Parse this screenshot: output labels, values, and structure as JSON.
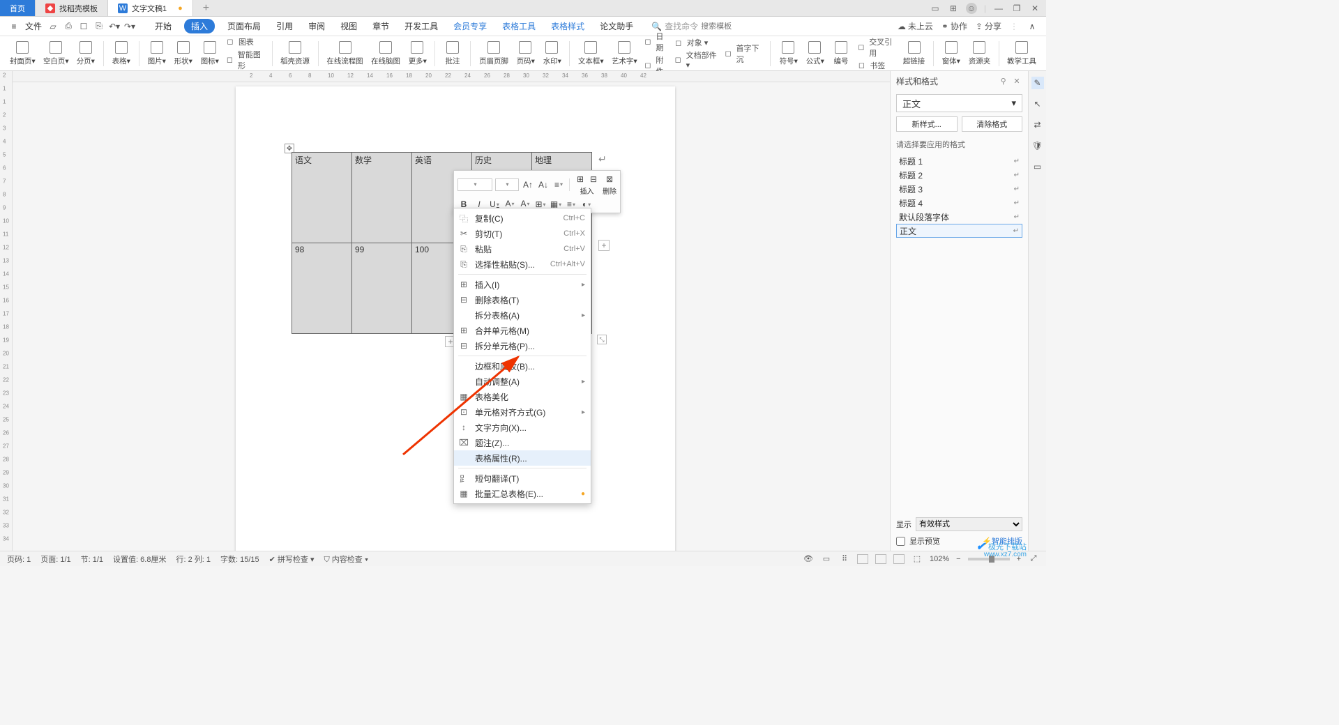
{
  "tabs": {
    "home": "首页",
    "template": "找稻壳模板",
    "doc": "文字文稿1"
  },
  "menubar": {
    "file": "文件",
    "tabs": [
      "开始",
      "插入",
      "页面布局",
      "引用",
      "审阅",
      "视图",
      "章节",
      "开发工具",
      "会员专享",
      "表格工具",
      "表格样式",
      "论文助手"
    ],
    "active": 1,
    "blue_idx": [
      8,
      9,
      10
    ],
    "search_icon_label": "查找命令",
    "search_placeholder": "搜索模板",
    "cloud": "未上云",
    "coop": "协作",
    "share": "分享"
  },
  "ribbon": [
    {
      "label": "封面页",
      "drop": true
    },
    {
      "label": "空白页",
      "drop": true
    },
    {
      "label": "分页",
      "drop": true
    },
    {
      "sep": true
    },
    {
      "label": "表格",
      "drop": true
    },
    {
      "sep": true
    },
    {
      "label": "图片",
      "drop": true
    },
    {
      "label": "形状",
      "drop": true
    },
    {
      "label": "图标",
      "drop": true
    },
    {
      "side": [
        {
          "label": "图表"
        },
        {
          "label": "智能图形"
        }
      ]
    },
    {
      "sep": true
    },
    {
      "label": "稻壳资源"
    },
    {
      "sep": true
    },
    {
      "label": "在线流程图"
    },
    {
      "label": "在线脑图"
    },
    {
      "label": "更多",
      "drop": true
    },
    {
      "sep": true
    },
    {
      "label": "批注"
    },
    {
      "sep": true
    },
    {
      "label": "页眉页脚"
    },
    {
      "label": "页码",
      "drop": true
    },
    {
      "label": "水印",
      "drop": true
    },
    {
      "sep": true
    },
    {
      "label": "文本框",
      "drop": true
    },
    {
      "label": "艺术字",
      "drop": true
    },
    {
      "side": [
        {
          "label": "日期"
        },
        {
          "label": "附件"
        }
      ]
    },
    {
      "side": [
        {
          "label": "对象"
        },
        {
          "label": "文档部件"
        }
      ],
      "drop": true
    },
    {
      "side": [
        {
          "label": "首字下沉"
        }
      ]
    },
    {
      "sep": true
    },
    {
      "label": "符号",
      "drop": true
    },
    {
      "label": "公式",
      "drop": true
    },
    {
      "label": "编号"
    },
    {
      "side": [
        {
          "label": "交叉引用"
        },
        {
          "label": "书签"
        }
      ]
    },
    {
      "label": "超链接"
    },
    {
      "sep": true
    },
    {
      "label": "窗体",
      "drop": true
    },
    {
      "label": "资源夹"
    },
    {
      "sep": true
    },
    {
      "label": "教学工具"
    }
  ],
  "ruler_h": [
    "2",
    "4",
    "6",
    "8",
    "10",
    "12",
    "14",
    "16",
    "18",
    "20",
    "22",
    "24",
    "26",
    "28",
    "30",
    "32",
    "34",
    "36",
    "38",
    "40",
    "42"
  ],
  "ruler_v": [
    "2",
    "1",
    "1",
    "2",
    "3",
    "4",
    "5",
    "6",
    "7",
    "8",
    "9",
    "10",
    "11",
    "12",
    "13",
    "14",
    "15",
    "16",
    "17",
    "18",
    "19",
    "20",
    "21",
    "22",
    "23",
    "24",
    "25",
    "26",
    "27",
    "28",
    "29",
    "30",
    "31",
    "32",
    "33",
    "34"
  ],
  "table": {
    "headers": [
      "语文",
      "数学",
      "英语",
      "历史",
      "地理"
    ],
    "row2": [
      "98",
      "99",
      "100",
      "",
      ""
    ]
  },
  "mini": {
    "insert": "插入",
    "delete": "删除"
  },
  "context_menu": [
    {
      "icon": "⿻",
      "label": "复制(C)",
      "shortcut": "Ctrl+C"
    },
    {
      "icon": "✂",
      "label": "剪切(T)",
      "shortcut": "Ctrl+X"
    },
    {
      "icon": "⎘",
      "label": "粘贴",
      "shortcut": "Ctrl+V"
    },
    {
      "icon": "⎘",
      "label": "选择性粘贴(S)...",
      "shortcut": "Ctrl+Alt+V"
    },
    {
      "sep": true
    },
    {
      "icon": "⊞",
      "label": "插入(I)",
      "sub": true
    },
    {
      "icon": "⊟",
      "label": "删除表格(T)"
    },
    {
      "icon": "",
      "label": "拆分表格(A)",
      "sub": true
    },
    {
      "icon": "⊞",
      "label": "合并单元格(M)"
    },
    {
      "icon": "⊟",
      "label": "拆分单元格(P)..."
    },
    {
      "sep": true
    },
    {
      "icon": "",
      "label": "边框和底纹(B)..."
    },
    {
      "icon": "",
      "label": "自动调整(A)",
      "sub": true
    },
    {
      "icon": "▦",
      "label": "表格美化"
    },
    {
      "icon": "⊡",
      "label": "单元格对齐方式(G)",
      "sub": true
    },
    {
      "icon": "↕",
      "label": "文字方向(X)..."
    },
    {
      "icon": "⌧",
      "label": "题注(Z)..."
    },
    {
      "icon": "",
      "label": "表格属性(R)...",
      "hover": true
    },
    {
      "sep": true
    },
    {
      "icon": "⻊",
      "label": "短句翻译(T)"
    },
    {
      "icon": "▦",
      "label": "批量汇总表格(E)...",
      "badge": true
    }
  ],
  "right_panel": {
    "title": "样式和格式",
    "current": "正文",
    "btn_new": "新样式...",
    "btn_clear": "清除格式",
    "apply_label": "请选择要应用的格式",
    "styles": [
      "标题 1",
      "标题 2",
      "标题 3",
      "标题 4",
      "默认段落字体",
      "正文"
    ],
    "selected": 5,
    "show_label": "显示",
    "show_value": "有效样式",
    "preview": "显示预览",
    "smart": "智能排版"
  },
  "statusbar": {
    "items": [
      "页码: 1",
      "页面: 1/1",
      "节: 1/1",
      "设置值: 6.8厘米",
      "行: 2  列: 1",
      "字数: 15/15",
      "拼写检查",
      "内容检查"
    ],
    "zoom": "102%"
  },
  "watermark": {
    "brand": "极光下载站",
    "url": "www.xz7.com"
  }
}
